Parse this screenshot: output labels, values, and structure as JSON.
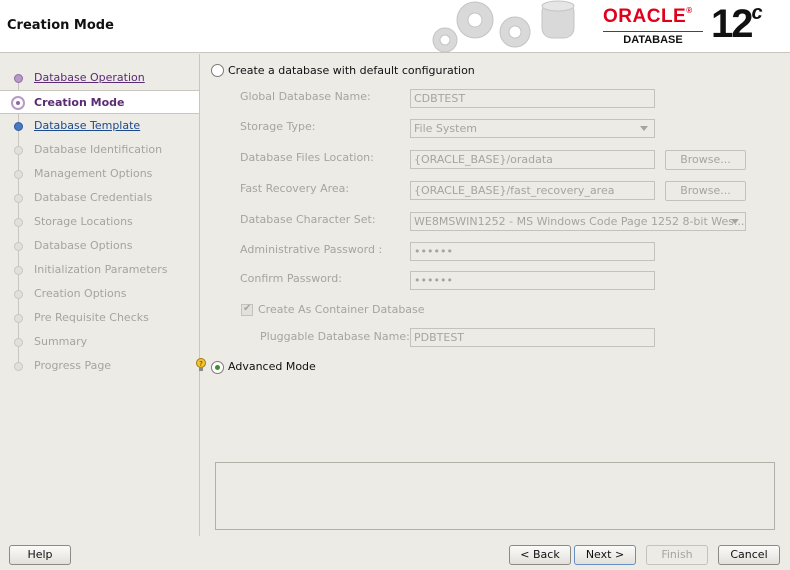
{
  "header": {
    "title": "Creation Mode",
    "logo_word": "ORACLE",
    "logo_registered": "®",
    "logo_sub": "DATABASE",
    "version": "12",
    "version_suffix": "c"
  },
  "steps": [
    {
      "label": "Database Operation",
      "state": "done"
    },
    {
      "label": "Creation Mode",
      "state": "current"
    },
    {
      "label": "Database Template",
      "state": "next"
    },
    {
      "label": "Database Identification",
      "state": "pending"
    },
    {
      "label": "Management Options",
      "state": "pending"
    },
    {
      "label": "Database Credentials",
      "state": "pending"
    },
    {
      "label": "Storage Locations",
      "state": "pending"
    },
    {
      "label": "Database Options",
      "state": "pending"
    },
    {
      "label": "Initialization Parameters",
      "state": "pending"
    },
    {
      "label": "Creation Options",
      "state": "pending"
    },
    {
      "label": "Pre Requisite Checks",
      "state": "pending"
    },
    {
      "label": "Summary",
      "state": "pending"
    },
    {
      "label": "Progress Page",
      "state": "pending"
    }
  ],
  "form": {
    "default_config_label": "Create a database with default configuration",
    "default_config_selected": false,
    "global_db_name_label": "Global Database Name:",
    "global_db_name_value": "CDBTEST",
    "storage_type_label": "Storage Type:",
    "storage_type_value": "File System",
    "db_files_location_label": "Database Files Location:",
    "db_files_location_value": "{ORACLE_BASE}/oradata",
    "fast_recovery_label": "Fast Recovery Area:",
    "fast_recovery_value": "{ORACLE_BASE}/fast_recovery_area",
    "charset_label": "Database Character Set:",
    "charset_value": "WE8MSWIN1252 - MS Windows Code Page 1252 8-bit Wes...",
    "admin_password_label": "Administrative Password :",
    "admin_password_value": "••••••",
    "confirm_password_label": "Confirm Password:",
    "confirm_password_value": "••••••",
    "container_db_label": "Create As Container Database",
    "container_db_checked": true,
    "pluggable_db_label": "Pluggable Database Name:",
    "pluggable_db_value": "PDBTEST",
    "browse_label": "Browse...",
    "advanced_mode_label": "Advanced Mode",
    "advanced_mode_selected": true
  },
  "footer": {
    "help": "Help",
    "back": "< Back",
    "next": "Next >",
    "finish": "Finish",
    "cancel": "Cancel"
  },
  "colors": {
    "accent_oracle_red": "#e0001b",
    "step_done": "#5a2a72",
    "step_next": "#1d4a8c",
    "radio_selected": "#3e8f2f"
  }
}
